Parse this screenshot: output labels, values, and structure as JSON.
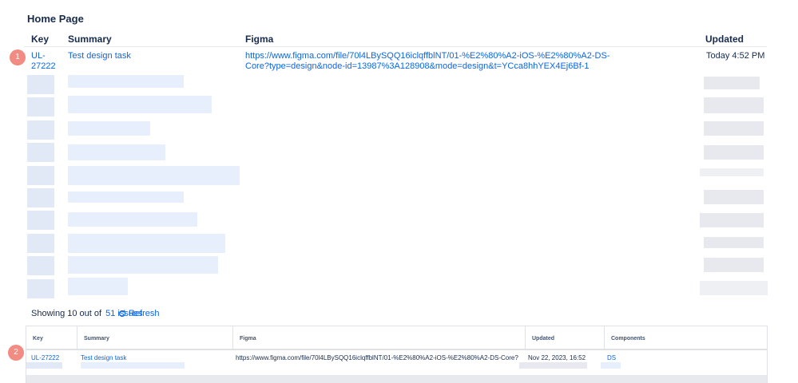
{
  "page": {
    "title": "Home Page"
  },
  "table1": {
    "columns": [
      "Key",
      "Summary",
      "Figma",
      "Updated"
    ],
    "row": {
      "key": "UL-\n27222",
      "summary": "Test design task",
      "figma": "https://www.figma.com/file/70l4LBySQQ16iclqffblNT/01-%E2%80%A2-iOS-%E2%80%A2-DS-Core?type=design&node-id=13987%3A128908&mode=design&t=YCca8hhYEX4Ej6Bf-1",
      "updated": "Today 4:52 PM"
    },
    "footer": {
      "showing_prefix": "Showing 10 out of",
      "issues_link": "51 issues",
      "refresh_label": "Refresh"
    }
  },
  "table2": {
    "columns": [
      "Key",
      "Summary",
      "Figma",
      "Updated",
      "Components"
    ],
    "row": {
      "key": "UL-27222",
      "summary": "Test design task",
      "figma": "https://www.figma.com/file/70l4LBySQQ16iclqffblNT/01-%E2%80%A2-iOS-%E2%80%A2-DS-Core?type...",
      "updated": "Nov 22, 2023, 16:52",
      "components": "DS"
    }
  },
  "annotations": [
    "1",
    "2"
  ],
  "colors": {
    "link": "#0c66e4",
    "badge": "#f28b82",
    "text": "#172b4d"
  }
}
